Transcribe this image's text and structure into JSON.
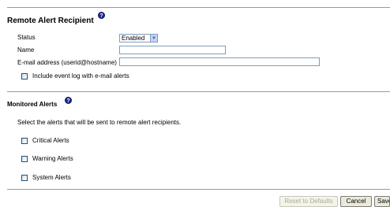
{
  "remote": {
    "title": "Remote Alert Recipient",
    "help_icon": "question-circle-icon",
    "status_label": "Status",
    "status_value": "Enabled",
    "name_label": "Name",
    "name_value": "",
    "email_label": "E-mail address (userid@hostname)",
    "email_value": "",
    "include_log_label": "Include event log with e-mail alerts",
    "include_log_checked": false
  },
  "monitored": {
    "title": "Monitored Alerts",
    "description": "Select the alerts that will be sent to remote alert recipients.",
    "alerts": [
      {
        "label": "Critical Alerts",
        "checked": false
      },
      {
        "label": "Warning Alerts",
        "checked": false
      },
      {
        "label": "System Alerts",
        "checked": false
      }
    ]
  },
  "actions": {
    "reset_label": "Reset to Defaults",
    "cancel_label": "Cancel",
    "save_label": "Save"
  },
  "colors": {
    "help_icon_bg": "#1a2a8c",
    "rule": "#999999",
    "disabled_text": "#aca899"
  }
}
